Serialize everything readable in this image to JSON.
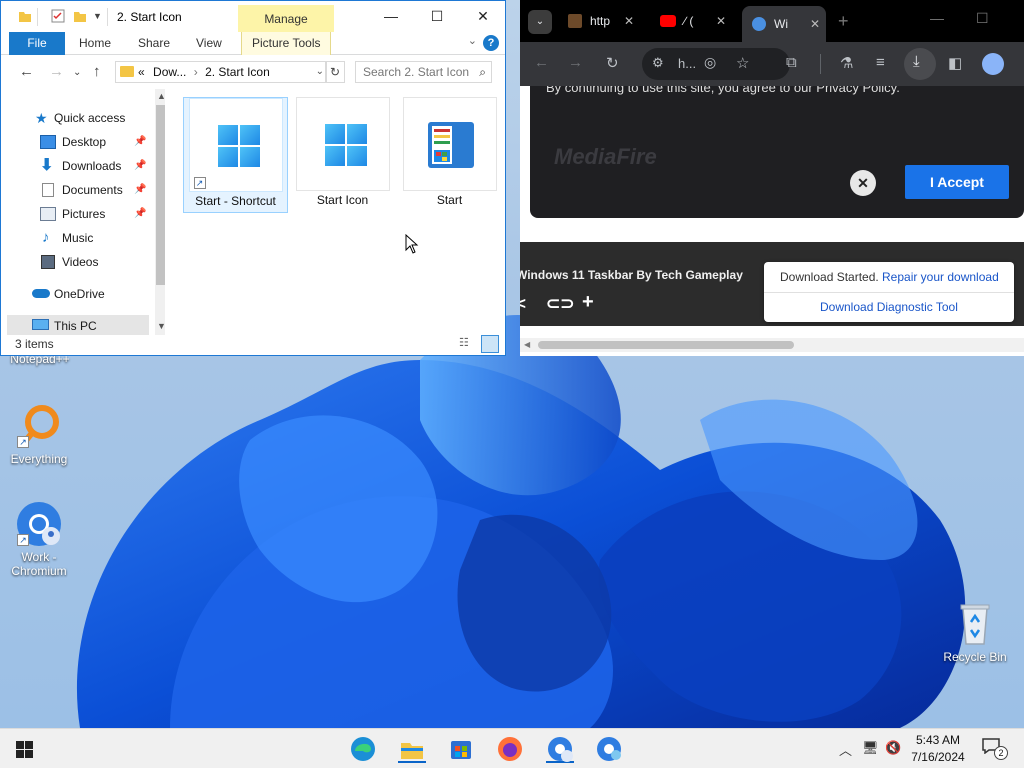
{
  "desktop": {
    "icons": [
      {
        "label": "Notepad++",
        "icon": "notepad-plus-plus-icon"
      },
      {
        "label": "Everything",
        "icon": "everything-search-icon"
      },
      {
        "label": "Work - Chromium",
        "icon": "chromium-icon"
      },
      {
        "label": "Recycle Bin",
        "icon": "recycle-bin-icon"
      }
    ]
  },
  "explorer": {
    "title": "2. Start Icon",
    "contextual_tab": "Manage",
    "ribbon_tabs": [
      "File",
      "Home",
      "Share",
      "View",
      "Picture Tools"
    ],
    "help_label": "?",
    "address": {
      "prefix": "«",
      "segments": [
        "Dow...",
        "2. Start Icon"
      ]
    },
    "search_placeholder": "Search 2. Start Icon",
    "nav": [
      {
        "label": "Quick access",
        "icon": "star-icon",
        "pinned": false
      },
      {
        "label": "Desktop",
        "icon": "desktop-folder-icon",
        "pinned": true
      },
      {
        "label": "Downloads",
        "icon": "download-folder-icon",
        "pinned": true
      },
      {
        "label": "Documents",
        "icon": "documents-folder-icon",
        "pinned": true
      },
      {
        "label": "Pictures",
        "icon": "pictures-folder-icon",
        "pinned": true
      },
      {
        "label": "Music",
        "icon": "music-folder-icon",
        "pinned": false
      },
      {
        "label": "Videos",
        "icon": "videos-folder-icon",
        "pinned": false
      },
      {
        "label": "OneDrive",
        "icon": "onedrive-icon",
        "pinned": false
      },
      {
        "label": "This PC",
        "icon": "this-pc-icon",
        "pinned": false
      }
    ],
    "files": [
      {
        "name": "Start - Shortcut",
        "selected": true,
        "shortcut": true
      },
      {
        "name": "Start Icon",
        "selected": false,
        "shortcut": false
      },
      {
        "name": "Start",
        "selected": false,
        "shortcut": false
      }
    ],
    "status": "3 items"
  },
  "browser": {
    "tabs": [
      {
        "label": "http",
        "icon": "site-favicon"
      },
      {
        "label": "∕ (",
        "icon": "youtube-icon"
      },
      {
        "label": "Wi",
        "icon": "chromium-favicon",
        "active": true
      }
    ],
    "omnibox": "h...",
    "consent_text": "By continuing to use this site, you agree to our Privacy Policy.",
    "consent_logo": "MediaFire",
    "accept_label": "I Accept",
    "close_label": "✕",
    "video_title": "Windows 11 Taskbar By Tech Gameplay",
    "download": {
      "started": "Download Started.",
      "repair": "Repair your download",
      "tool": "Download Diagnostic Tool"
    }
  },
  "taskbar": {
    "apps": [
      "edge-icon",
      "file-explorer-icon",
      "microsoft-store-icon",
      "firefox-icon",
      "chromium-work-icon",
      "chromium-icon"
    ],
    "time": "5:43 AM",
    "date": "7/16/2024",
    "notifications": "2"
  },
  "colors": {
    "explorer_accent": "#1979ca",
    "manage_tab": "#fdf4a8",
    "accept_button": "#1a73e8",
    "link": "#1a56c9"
  }
}
